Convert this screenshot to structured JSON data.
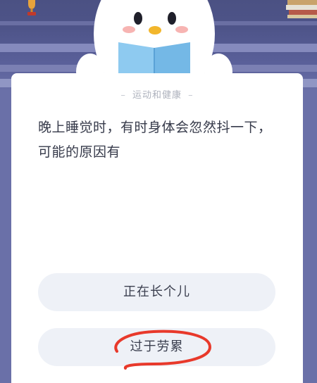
{
  "quiz": {
    "category": "运动和健康",
    "category_dash_left": "–",
    "category_dash_right": "–",
    "question": "晚上睡觉时，有时身体会忽然抖一下，可能的原因有",
    "options": [
      {
        "label": "正在长个儿"
      },
      {
        "label": "过于劳累"
      }
    ]
  },
  "colors": {
    "header_bg": "#4e5489",
    "card_bg": "#ffffff",
    "option_bg": "#eef1f7",
    "annotation_red": "#e8392b"
  },
  "icons": {
    "mascot": "penguin-reading-book-icon",
    "trophy": "trophy-icon",
    "books": "book-stack-icon"
  }
}
